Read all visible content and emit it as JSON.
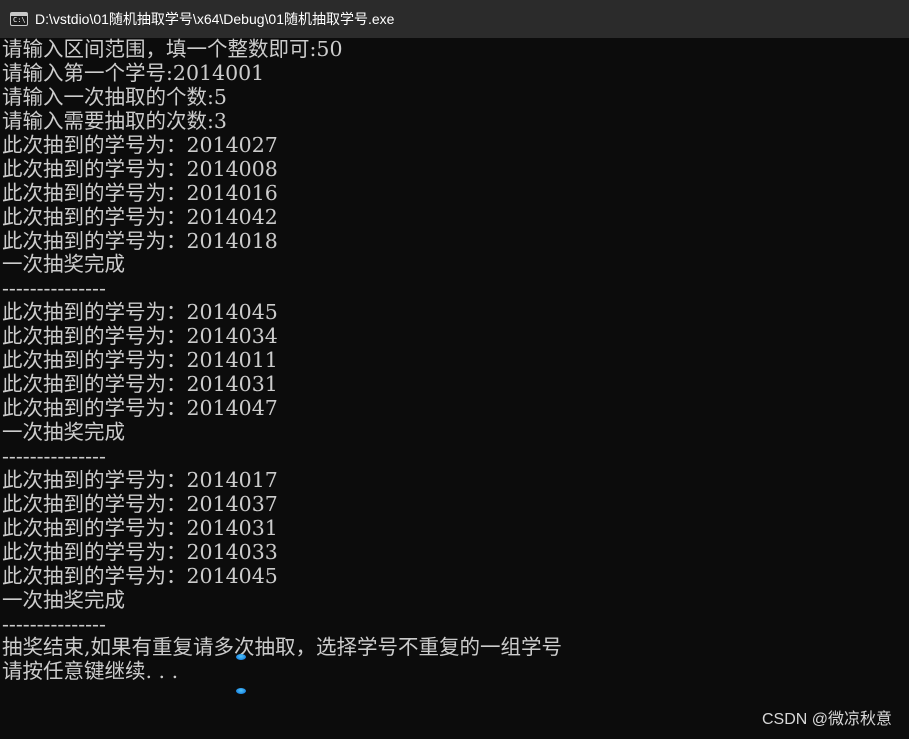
{
  "window": {
    "title": "D:\\vstdio\\01随机抽取学号\\x64\\Debug\\01随机抽取学号.exe",
    "icon": "console-app-icon",
    "icon_glyph": "C:\\"
  },
  "console": {
    "lines": [
      "请输入区间范围，填一个整数即可:50",
      "请输入第一个学号:2014001",
      "请输入一次抽取的个数:5",
      "请输入需要抽取的次数:3",
      "此次抽到的学号为：2014027",
      "此次抽到的学号为：2014008",
      "此次抽到的学号为：2014016",
      "此次抽到的学号为：2014042",
      "此次抽到的学号为：2014018",
      "一次抽奖完成",
      "---------------",
      "此次抽到的学号为：2014045",
      "此次抽到的学号为：2014034",
      "此次抽到的学号为：2014011",
      "此次抽到的学号为：2014031",
      "此次抽到的学号为：2014047",
      "一次抽奖完成",
      "---------------",
      "此次抽到的学号为：2014017",
      "此次抽到的学号为：2014037",
      "此次抽到的学号为：2014031",
      "此次抽到的学号为：2014033",
      "此次抽到的学号为：2014045",
      "一次抽奖完成",
      "---------------",
      "抽奖结束,如果有重复请多次抽取，选择学号不重复的一组学号",
      "请按任意键继续. . ."
    ]
  },
  "watermark": "CSDN @微凉秋意",
  "colors": {
    "titlebar_bg": "#2b2b2b",
    "console_bg": "#0c0c0c",
    "console_text": "#cccccc",
    "title_text": "#ffffff",
    "cursor_accent": "#1e88e5"
  }
}
